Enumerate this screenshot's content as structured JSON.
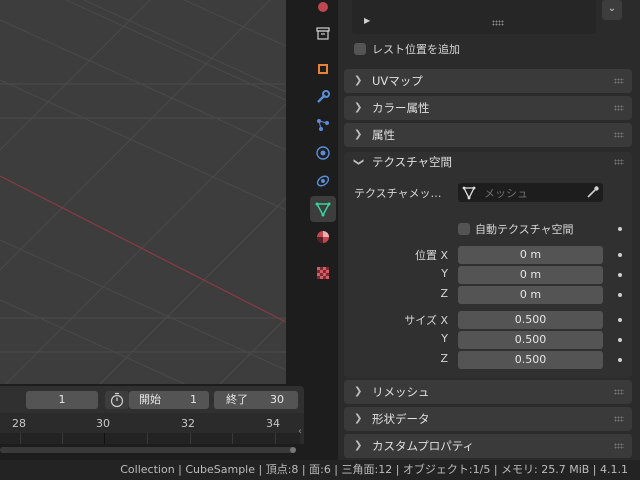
{
  "timeline": {
    "current_frame": "1",
    "start_label": "開始",
    "start_value": "1",
    "end_label": "終了",
    "end_value": "30",
    "frame_numbers": [
      "28",
      "30",
      "32",
      "34"
    ]
  },
  "properties": {
    "add_rest_position_label": "レスト位置を追加",
    "panels": {
      "uv_maps": "UVマップ",
      "color_attributes": "カラー属性",
      "attributes": "属性",
      "texture_space": "テクスチャ空間",
      "remesh": "リメッシュ",
      "shape_data": "形状データ",
      "custom_properties": "カスタムプロパティ"
    },
    "texture_space": {
      "texture_mesh_label": "テクスチャメッ…",
      "texture_mesh_placeholder": "メッシュ",
      "auto_texture_space_label": "自動テクスチャ空間",
      "location_label": "位置",
      "size_label": "サイズ",
      "axis_x": "X",
      "axis_y": "Y",
      "axis_z": "Z",
      "location": {
        "x": "0 m",
        "y": "0 m",
        "z": "0 m"
      },
      "size": {
        "x": "0.500",
        "y": "0.500",
        "z": "0.500"
      }
    }
  },
  "status_bar": {
    "text": "Collection | CubeSample | 頂点:8 | 面:6 | 三角面:12 | オブジェクト:1/5 | メモリ: 25.7 MiB | 4.1.1"
  },
  "colors": {
    "viewport_bg": "#3d3d3d",
    "grid_line": "#4a4a4a",
    "x_axis": "#8a3a44",
    "active_tab_icon": "#36d39a",
    "playhead": "#4d8ae8"
  }
}
